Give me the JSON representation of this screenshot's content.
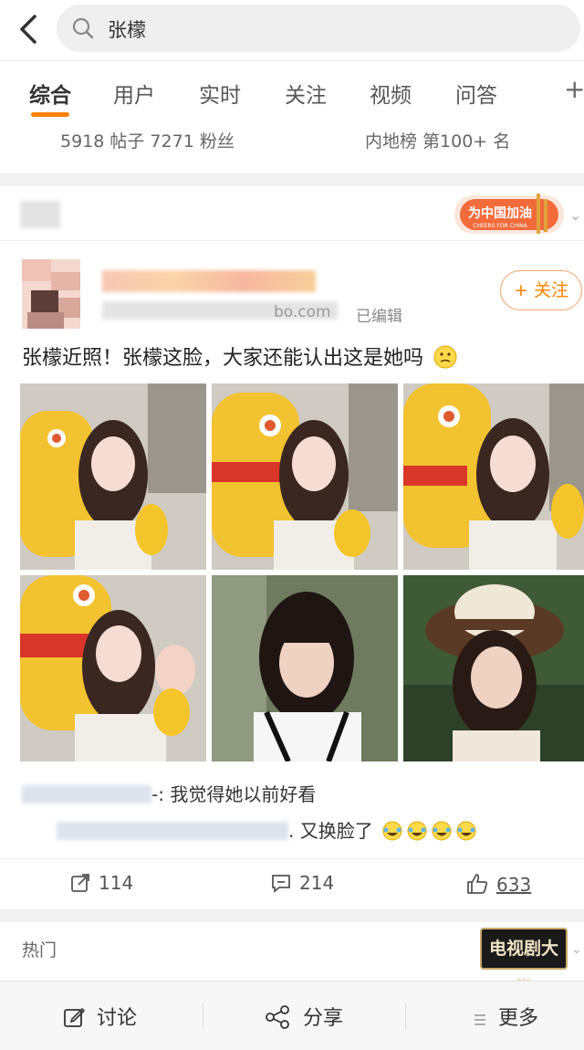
{
  "search": {
    "query": "张檬"
  },
  "tabs": [
    {
      "label": "综合",
      "active": true
    },
    {
      "label": "用户"
    },
    {
      "label": "实时"
    },
    {
      "label": "关注"
    },
    {
      "label": "视频"
    },
    {
      "label": "问答"
    }
  ],
  "stats": {
    "left": "5918 帖子  7271 粉丝",
    "right": "内地榜 第100+ 名"
  },
  "post": {
    "badge_cn": "为中国加油",
    "badge_en": "CHEERS FOR CHINA",
    "meta_domain": "bo.com",
    "meta_edited": "已编辑",
    "follow_label": "+ 关注",
    "text": "张檬近照！张檬这脸，大家还能认出这是她吗",
    "comments": [
      {
        "prefix": "-:",
        "text": "我觉得她以前好看"
      },
      {
        "text": ". 又换脸了"
      }
    ],
    "actions": {
      "repost": "114",
      "comment": "214",
      "like": "633"
    }
  },
  "hot": {
    "label": "热门",
    "badge": "电视剧大赏"
  },
  "bottom": {
    "discuss": "讨论",
    "share": "分享",
    "more": "更多"
  },
  "colors": {
    "accent": "#ff8200",
    "bg": "#f2f2f2"
  }
}
